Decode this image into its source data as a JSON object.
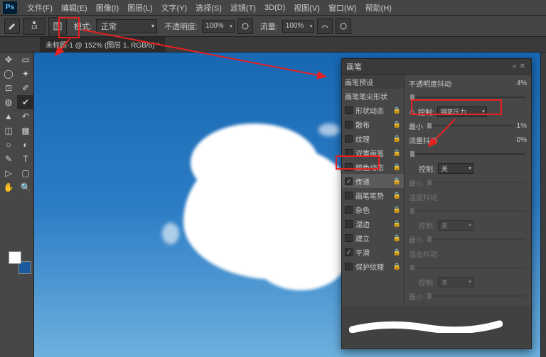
{
  "app": {
    "logo": "Ps"
  },
  "menu": {
    "file": "文件(F)",
    "edit": "编辑(E)",
    "image": "图像(I)",
    "layer": "图层(L)",
    "type": "文字(Y)",
    "select": "选择(S)",
    "filter": "滤镜(T)",
    "3d": "3D(D)",
    "view": "视图(V)",
    "window": "窗口(W)",
    "help": "帮助(H)"
  },
  "opt": {
    "size": "13",
    "mode_lbl": "模式:",
    "mode_v": "正常",
    "opac_lbl": "不透明度:",
    "opac_v": "100%",
    "flow_lbl": "流量:",
    "flow_v": "100%"
  },
  "tab": {
    "name": "未标题-1 @ 152% (图层 1, RGB/8) *"
  },
  "panel": {
    "title": "画笔",
    "rows": {
      "preset": "画笔预设",
      "tip": "画笔笔尖形状",
      "shape": "形状动态",
      "scatter": "散布",
      "texture": "纹理",
      "dual": "双重画笔",
      "color": "颜色动态",
      "transfer": "传递",
      "pose": "画笔笔势",
      "noise": "杂色",
      "wet": "湿边",
      "build": "建立",
      "smooth": "平滑",
      "protect": "保护纹理"
    }
  },
  "right": {
    "opac_jit": "不透明度抖动",
    "opac_jit_v": "4%",
    "ctrl_lbl": "控制:",
    "pen": "钢笔压力",
    "min": "最小",
    "min_v": "1%",
    "flow_jit": "流量抖动",
    "flow_jit_v": "0%",
    "off": "关",
    "wet_jit": "湿度抖动",
    "mix_jit": "混合抖动"
  }
}
